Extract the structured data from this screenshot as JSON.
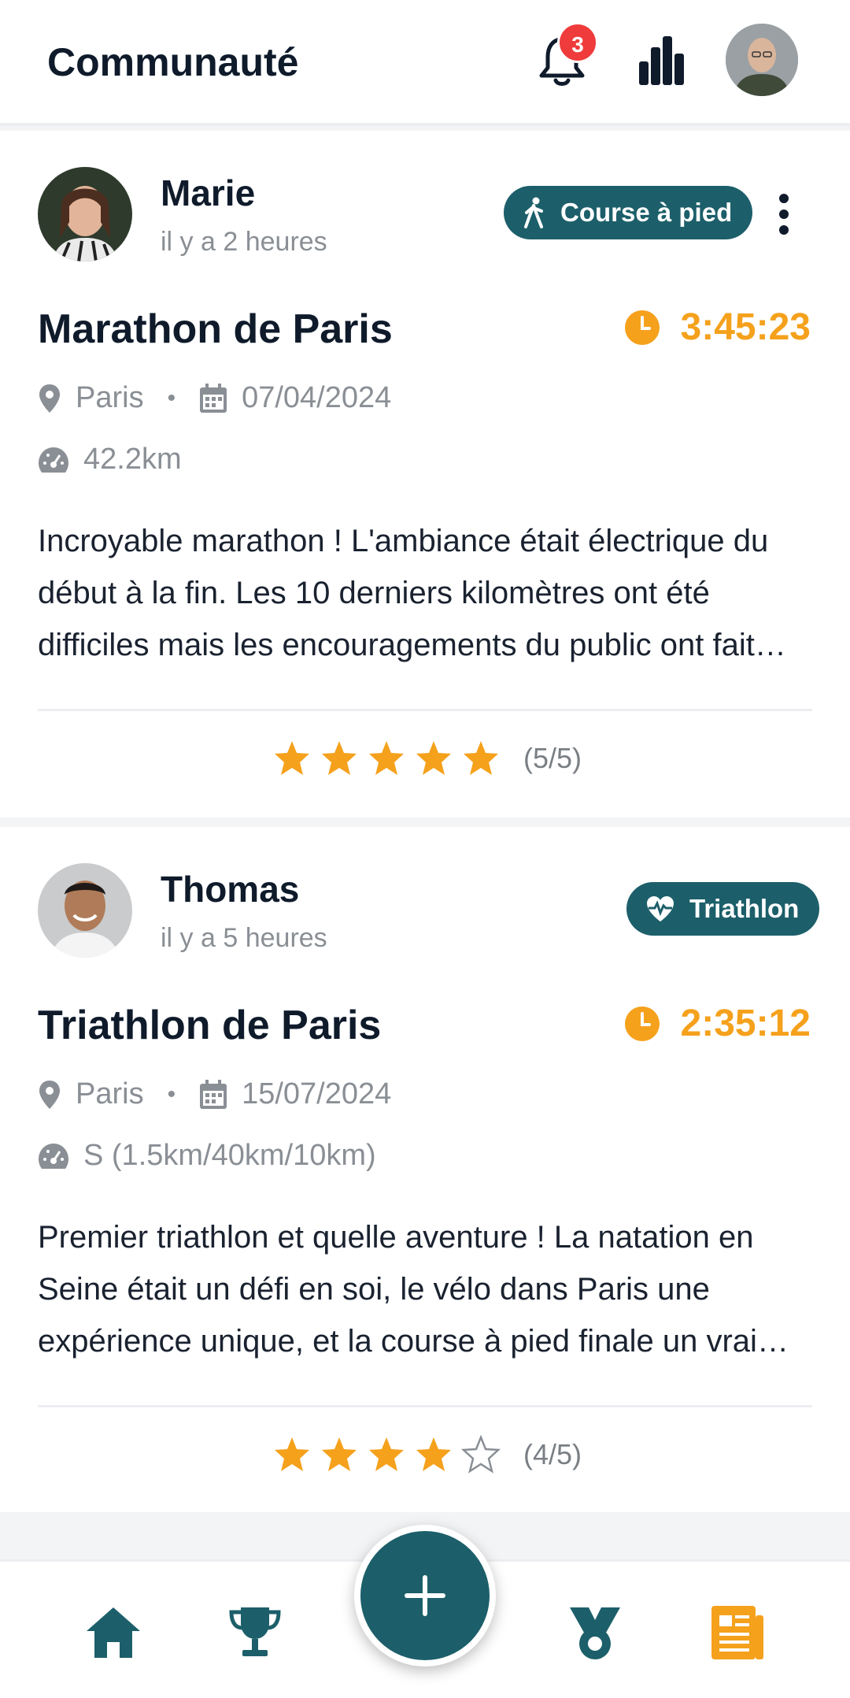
{
  "header": {
    "title": "Communauté",
    "notification_count": "3",
    "icons": [
      "bell-icon",
      "stats-icon",
      "avatar"
    ]
  },
  "posts": [
    {
      "user": "Marie",
      "time_ago": "il y a 2 heures",
      "sport": "Course à pied",
      "sport_icon": "walking-icon",
      "title": "Marathon de Paris",
      "duration": "3:45:23",
      "location": "Paris",
      "date": "07/04/2024",
      "distance": "42.2km",
      "description": "Incroyable marathon ! L'ambiance était électrique du début à la fin. Les 10 derniers kilomètres ont été difficiles mais les encouragements du public ont fait toute la différence.",
      "rating": 5,
      "rating_text": "(5/5)"
    },
    {
      "user": "Thomas",
      "time_ago": "il y a 5 heures",
      "sport": "Triathlon",
      "sport_icon": "heart-pulse-icon",
      "title": "Triathlon de Paris",
      "duration": "2:35:12",
      "location": "Paris",
      "date": "15/07/2024",
      "distance": "S (1.5km/40km/10km)",
      "description": "Premier triathlon et quelle aventure ! La natation en Seine était un défi en soi, le vélo dans Paris une expérience unique, et la course à pied finale un vrai moment de bonheur.",
      "rating": 4,
      "rating_text": "(4/5)"
    }
  ],
  "bottom_nav": {
    "items": [
      "home-icon",
      "trophy-icon",
      "add-button",
      "medal-icon",
      "news-icon"
    ],
    "active": "news-icon"
  },
  "colors": {
    "primary": "#1c5f6a",
    "accent": "#f5a11c",
    "badge": "#ef3b3b"
  }
}
